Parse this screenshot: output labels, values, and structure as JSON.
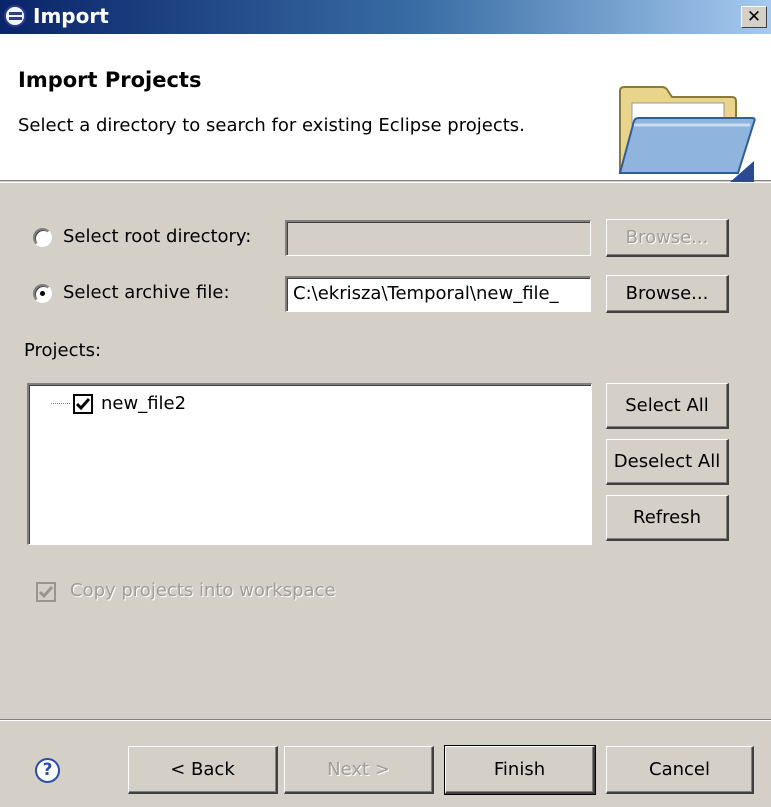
{
  "window": {
    "title": "Import",
    "close_glyph": "✕"
  },
  "header": {
    "title": "Import Projects",
    "description": "Select a directory to search for existing Eclipse projects."
  },
  "source": {
    "root_directory": {
      "label": "Select root directory:",
      "value": "",
      "browse_label": "Browse...",
      "selected": false,
      "enabled": false
    },
    "archive_file": {
      "label": "Select archive file:",
      "value": "C:\\ekrisza\\Temporal\\new_file_",
      "browse_label": "Browse...",
      "selected": true
    }
  },
  "projects": {
    "label": "Projects:",
    "items": [
      {
        "name": "new_file2",
        "checked": true
      }
    ],
    "select_all_label": "Select All",
    "deselect_all_label": "Deselect All",
    "refresh_label": "Refresh"
  },
  "options": {
    "copy_label": "Copy projects into workspace",
    "copy_checked": true,
    "copy_enabled": false
  },
  "footer": {
    "help_glyph": "?",
    "back_label": "< Back",
    "next_label": "Next >",
    "finish_label": "Finish",
    "cancel_label": "Cancel"
  },
  "icons": [
    "eclipse-icon",
    "close-icon",
    "folder-icon",
    "help-icon",
    "checkmark-icon"
  ],
  "colors": {
    "titlebar_start": "#0a246a",
    "titlebar_end": "#a6caf0",
    "dialog_bg": "#d4d0c8"
  }
}
